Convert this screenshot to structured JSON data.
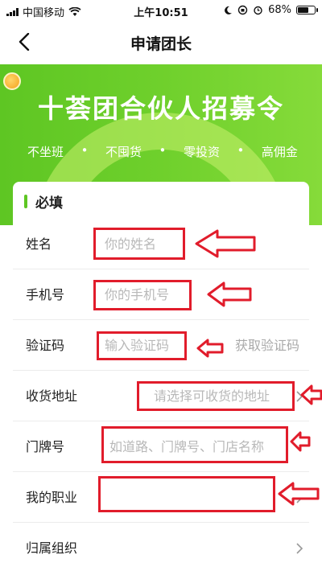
{
  "status_bar": {
    "carrier": "中国移动",
    "time": "上午10:51",
    "battery": "68%",
    "battery_level": 0.68
  },
  "nav": {
    "title": "申请团长",
    "back_icon": "chevron-left-icon"
  },
  "banner": {
    "headline": "十荟团合伙人招募令",
    "slogans": [
      "不坐班",
      "不囤货",
      "零投资",
      "高佣金"
    ],
    "separator": "•"
  },
  "form": {
    "section_label": "必填",
    "fields": [
      {
        "label": "姓名",
        "placeholder": "你的姓名"
      },
      {
        "label": "手机号",
        "placeholder": "你的手机号"
      },
      {
        "label": "验证码",
        "placeholder": "输入验证码",
        "action": "获取验证码"
      },
      {
        "label": "收货地址",
        "placeholder": "请选择可收货的地址"
      },
      {
        "label": "门牌号",
        "placeholder": "如道路、门牌号、门店名称"
      },
      {
        "label": "我的职业",
        "placeholder": ""
      },
      {
        "label": "归属组织",
        "placeholder": ""
      }
    ]
  },
  "colors": {
    "accent": "#5ec623",
    "annotation": "#e11c2b"
  }
}
